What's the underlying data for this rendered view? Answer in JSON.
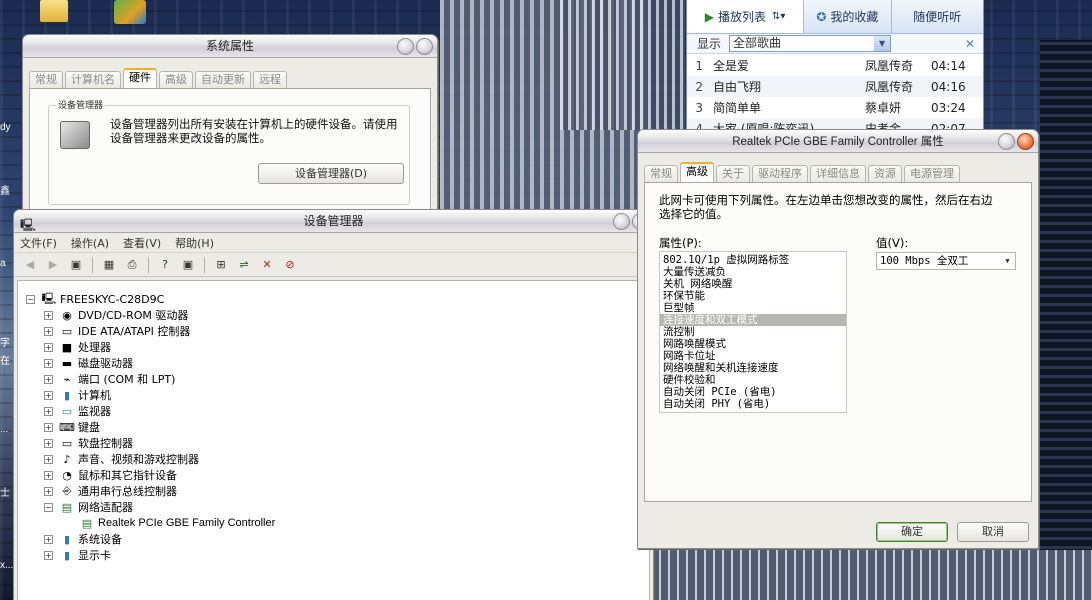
{
  "sys_props": {
    "title": "系统属性",
    "tabs": [
      "常规",
      "计算机名",
      "硬件",
      "高级",
      "自动更新",
      "远程"
    ],
    "group_title": "设备管理器",
    "description": "设备管理器列出所有安装在计算机上的硬件设备。请使用设备管理器来更改设备的属性。",
    "button": "设备管理器(D)"
  },
  "devmgr": {
    "title": "设备管理器",
    "menu": [
      "文件(F)",
      "操作(A)",
      "查看(V)",
      "帮助(H)"
    ],
    "root": "FREESKYC-C28D9C",
    "items": [
      {
        "label": "DVD/CD-ROM 驱动器",
        "icon": "disc-drive-icon",
        "glyph": "💿"
      },
      {
        "label": "IDE ATA/ATAPI 控制器",
        "icon": "ide-controller-icon",
        "glyph": "▭"
      },
      {
        "label": "处理器",
        "icon": "processor-icon",
        "glyph": "▪"
      },
      {
        "label": "磁盘驱动器",
        "icon": "disk-drive-icon",
        "glyph": "▬"
      },
      {
        "label": "端口 (COM 和 LPT)",
        "icon": "port-icon",
        "glyph": "⌁"
      },
      {
        "label": "计算机",
        "icon": "computer-icon",
        "glyph": "🖥"
      },
      {
        "label": "监视器",
        "icon": "monitor-icon",
        "glyph": "🖵"
      },
      {
        "label": "键盘",
        "icon": "keyboard-icon",
        "glyph": "⌨"
      },
      {
        "label": "软盘控制器",
        "icon": "floppy-controller-icon",
        "glyph": "▭"
      },
      {
        "label": "声音、视频和游戏控制器",
        "icon": "sound-icon",
        "glyph": "♪"
      },
      {
        "label": "鼠标和其它指针设备",
        "icon": "mouse-icon",
        "glyph": "🖱"
      },
      {
        "label": "通用串行总线控制器",
        "icon": "usb-icon",
        "glyph": "⎆"
      },
      {
        "label": "网络适配器",
        "icon": "network-adapter-icon",
        "glyph": "▤"
      },
      {
        "label": "Realtek PCIe GBE Family Controller",
        "icon": "network-card-icon",
        "glyph": "▤"
      },
      {
        "label": "系统设备",
        "icon": "system-device-icon",
        "glyph": "🖥"
      },
      {
        "label": "显示卡",
        "icon": "display-adapter-icon",
        "glyph": "🖥"
      }
    ]
  },
  "player": {
    "tabs": [
      "播放列表",
      "我的收藏",
      "随便听听"
    ],
    "filter_label": "显示",
    "filter_value": "全部歌曲",
    "songs": [
      {
        "n": "1",
        "title": "全是爱",
        "artist": "凤凰传奇",
        "dur": "04:14"
      },
      {
        "n": "2",
        "title": "自由飞翔",
        "artist": "凤凰传奇",
        "dur": "04:16"
      },
      {
        "n": "3",
        "title": "简简单单",
        "artist": "蔡卓妍",
        "dur": "03:24"
      },
      {
        "n": "4",
        "title": "大家 (原唱:陈奕迅)",
        "artist": "史孝金",
        "dur": "02:07"
      }
    ]
  },
  "nic_props": {
    "title": "Realtek PCIe GBE Family Controller 属性",
    "tabs": [
      "常规",
      "高级",
      "关于",
      "驱动程序",
      "详细信息",
      "资源",
      "电源管理"
    ],
    "description": "此网卡可使用下列属性。在左边单击您想改变的属性，然后在右边选择它的值。",
    "prop_label": "属性(P):",
    "value_label": "值(V):",
    "value": "100 Mbps 全双工",
    "properties": [
      "802.1Q/1p 虚拟网路标签",
      "大量传送减负",
      "关机 网络唤醒",
      "环保节能",
      "巨型帧",
      "连接速度和双工模式",
      "流控制",
      "网路唤醒模式",
      "网路卡位址",
      "网络唤醒和关机连接速度",
      "硬件校验和",
      "自动关闭 PCIe (省电)",
      "自动关闭 PHY (省电)"
    ],
    "selected_index": 5,
    "ok": "确定",
    "cancel": "取消"
  },
  "desktop": {
    "left_labels": [
      "dy",
      "鑫",
      "a",
      "字",
      "在",
      "...",
      "士",
      "x..."
    ]
  }
}
